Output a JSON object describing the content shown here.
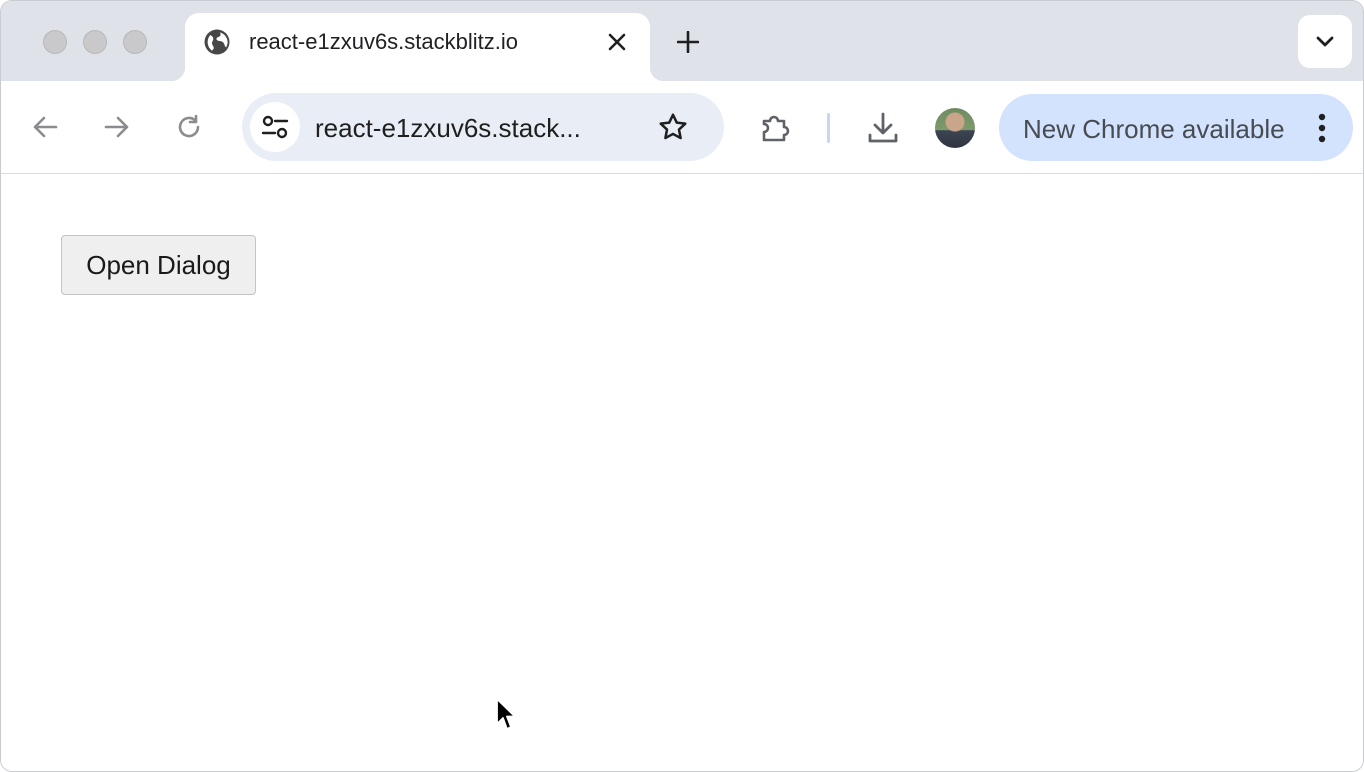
{
  "browser": {
    "tab": {
      "title": "react-e1zxuv6s.stackblitz.io",
      "favicon": "globe-icon"
    },
    "new_tab_icon": "plus-icon",
    "tab_search_icon": "chevron-down-icon",
    "toolbar": {
      "back_icon": "arrow-left-icon",
      "forward_icon": "arrow-right-icon",
      "reload_icon": "reload-icon",
      "site_info_icon": "tune-icon",
      "url": "react-e1zxuv6s.stack...",
      "bookmark_icon": "star-icon",
      "extensions_icon": "puzzle-icon",
      "download_icon": "download-icon",
      "update_chip": {
        "label": "New Chrome available",
        "menu_icon": "kebab-icon"
      }
    }
  },
  "page": {
    "open_dialog_label": "Open Dialog"
  },
  "colors": {
    "tabstrip_bg": "#dfe3e9",
    "omnibox_bg": "#e9eef6",
    "update_chip_bg": "#d3e3fd",
    "button_bg": "#efefef"
  }
}
